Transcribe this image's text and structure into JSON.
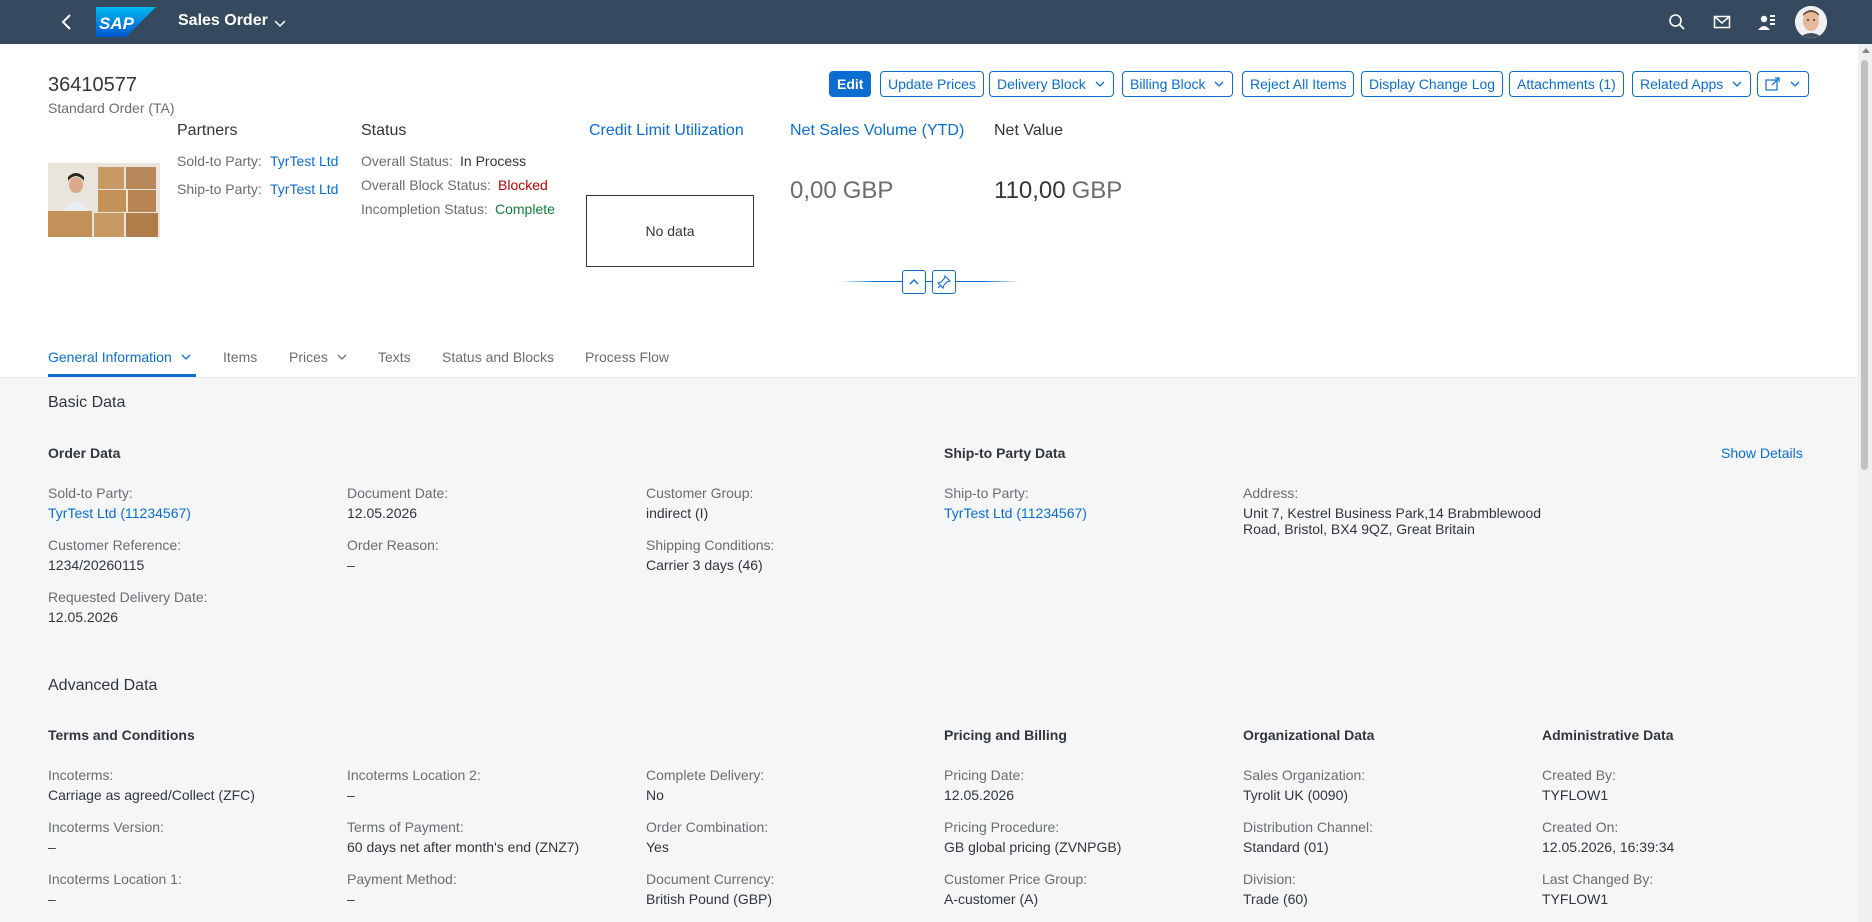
{
  "shell": {
    "app_title": "Sales Order",
    "logo_text": "SAP",
    "icons": [
      "back-icon",
      "search-icon",
      "mail-icon",
      "user-settings-icon",
      "avatar"
    ]
  },
  "header": {
    "object_id": "36410577",
    "object_subtitle": "Standard Order (TA)",
    "actions": {
      "edit": "Edit",
      "update_prices": "Update Prices",
      "delivery_block": "Delivery Block",
      "billing_block": "Billing Block",
      "reject_all_items": "Reject All Items",
      "display_change_log": "Display Change Log",
      "attachments": "Attachments (1)",
      "related_apps": "Related Apps"
    },
    "partners": {
      "title": "Partners",
      "sold_to_label": "Sold-to Party:",
      "sold_to_value": "TyrTest Ltd",
      "ship_to_label": "Ship-to Party:",
      "ship_to_value": "TyrTest Ltd"
    },
    "status": {
      "title": "Status",
      "overall_label": "Overall Status:",
      "overall_value": "In Process",
      "block_label": "Overall Block Status:",
      "block_value": "Blocked",
      "incompletion_label": "Incompletion Status:",
      "incompletion_value": "Complete"
    },
    "credit_limit": {
      "title": "Credit Limit Utilization",
      "no_data": "No data"
    },
    "net_sales": {
      "title": "Net Sales Volume (YTD)",
      "value": "0,00",
      "unit": "GBP"
    },
    "net_value": {
      "title": "Net Value",
      "value": "110,00",
      "unit": "GBP"
    },
    "colors": {
      "shell": "#354a5f",
      "accent": "#0a6ed1",
      "error": "#bb0000",
      "success": "#107e3e"
    }
  },
  "tabs": {
    "general_information": "General Information",
    "items": "Items",
    "prices": "Prices",
    "texts": "Texts",
    "status_and_blocks": "Status and Blocks",
    "process_flow": "Process Flow"
  },
  "basic_data": {
    "title": "Basic Data",
    "order_data": {
      "title": "Order Data",
      "sold_to_label": "Sold-to Party:",
      "sold_to_value": "TyrTest Ltd (11234567)",
      "document_date_label": "Document Date:",
      "document_date_value": "12.05.2026",
      "customer_group_label": "Customer Group:",
      "customer_group_value": "indirect (I)",
      "customer_reference_label": "Customer Reference:",
      "customer_reference_value": "1234/20260115",
      "order_reason_label": "Order Reason:",
      "order_reason_value": "–",
      "shipping_conditions_label": "Shipping Conditions:",
      "shipping_conditions_value": "Carrier 3 days (46)",
      "requested_delivery_label": "Requested Delivery Date:",
      "requested_delivery_value": "12.05.2026"
    },
    "ship_to_data": {
      "title": "Ship-to Party Data",
      "show_details": "Show Details",
      "ship_to_label": "Ship-to Party:",
      "ship_to_value": "TyrTest Ltd (11234567)",
      "address_label": "Address:",
      "address_line1": "Unit 7, Kestrel Business Park,14 Brabmblewood",
      "address_line2": "Road, Bristol, BX4 9QZ, Great Britain"
    }
  },
  "advanced_data": {
    "title": "Advanced Data",
    "terms": {
      "title": "Terms and Conditions",
      "incoterms_label": "Incoterms:",
      "incoterms_value": "Carriage as agreed/Collect (ZFC)",
      "incoterms_loc2_label": "Incoterms Location 2:",
      "incoterms_loc2_value": "–",
      "complete_delivery_label": "Complete Delivery:",
      "complete_delivery_value": "No",
      "incoterms_version_label": "Incoterms Version:",
      "incoterms_version_value": "–",
      "terms_payment_label": "Terms of Payment:",
      "terms_payment_value": "60 days net after month's end (ZNZ7)",
      "order_combination_label": "Order Combination:",
      "order_combination_value": "Yes",
      "incoterms_loc1_label": "Incoterms Location 1:",
      "incoterms_loc1_value": "–",
      "payment_method_label": "Payment Method:",
      "payment_method_value": "–",
      "document_currency_label": "Document Currency:",
      "document_currency_value": "British Pound (GBP)"
    },
    "pricing": {
      "title": "Pricing and Billing",
      "pricing_date_label": "Pricing Date:",
      "pricing_date_value": "12.05.2026",
      "pricing_procedure_label": "Pricing Procedure:",
      "pricing_procedure_value": "GB global pricing (ZVNPGB)",
      "customer_price_group_label": "Customer Price Group:",
      "customer_price_group_value": "A-customer (A)"
    },
    "organizational": {
      "title": "Organizational Data",
      "sales_org_label": "Sales Organization:",
      "sales_org_value": "Tyrolit UK (0090)",
      "distribution_channel_label": "Distribution Channel:",
      "distribution_channel_value": "Standard (01)",
      "division_label": "Division:",
      "division_value": "Trade (60)"
    },
    "administrative": {
      "title": "Administrative Data",
      "created_by_label": "Created By:",
      "created_by_value": "TYFLOW1",
      "created_on_label": "Created On:",
      "created_on_value": "12.05.2026, 16:39:34",
      "last_changed_by_label": "Last Changed By:",
      "last_changed_by_value": "TYFLOW1"
    }
  }
}
